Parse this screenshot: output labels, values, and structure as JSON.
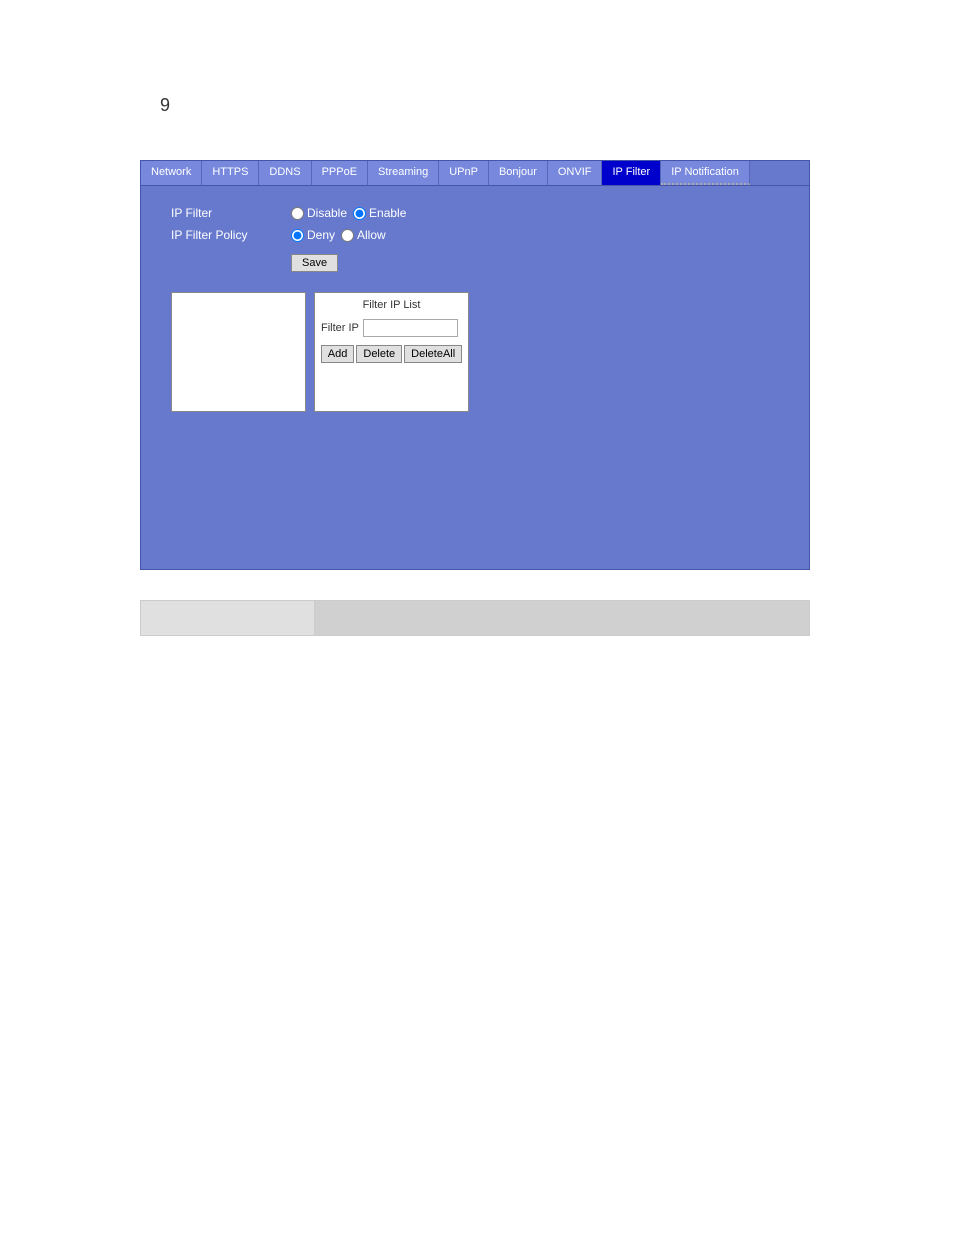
{
  "page": {
    "number": "9"
  },
  "tabs": [
    {
      "id": "network",
      "label": "Network",
      "active": false
    },
    {
      "id": "https",
      "label": "HTTPS",
      "active": false
    },
    {
      "id": "ddns",
      "label": "DDNS",
      "active": false
    },
    {
      "id": "pppoe",
      "label": "PPPoE",
      "active": false
    },
    {
      "id": "streaming",
      "label": "Streaming",
      "active": false
    },
    {
      "id": "upnp",
      "label": "UPnP",
      "active": false
    },
    {
      "id": "bonjour",
      "label": "Bonjour",
      "active": false
    },
    {
      "id": "onvif",
      "label": "ONVIF",
      "active": false
    },
    {
      "id": "ipfilter",
      "label": "IP Filter",
      "active": true
    },
    {
      "id": "ipnotification",
      "label": "IP Notification",
      "active": false
    }
  ],
  "form": {
    "ip_filter_label": "IP Filter",
    "ip_filter_policy_label": "IP Filter Policy",
    "disable_label": "Disable",
    "enable_label": "Enable",
    "deny_label": "Deny",
    "allow_label": "Allow",
    "save_label": "Save",
    "ip_filter_value": "enable",
    "ip_filter_policy_value": "deny"
  },
  "filter_panel": {
    "title": "Filter IP List",
    "filter_ip_label": "Filter IP",
    "filter_ip_value": "",
    "add_label": "Add",
    "delete_label": "Delete",
    "deleteall_label": "DeleteAll"
  }
}
